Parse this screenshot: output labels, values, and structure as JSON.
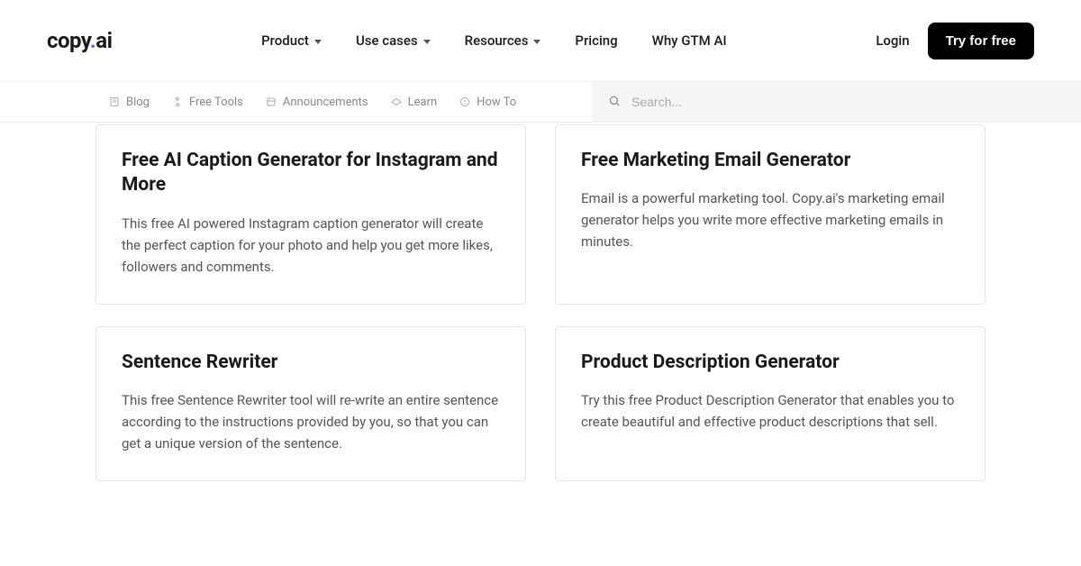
{
  "logo": {
    "part1": "copy",
    "part2": ".",
    "part3": "ai"
  },
  "nav": {
    "product": "Product",
    "use_cases": "Use cases",
    "resources": "Resources",
    "pricing": "Pricing",
    "why_gtm": "Why GTM AI"
  },
  "header": {
    "login": "Login",
    "cta": "Try for free"
  },
  "subnav": {
    "blog": "Blog",
    "free_tools": "Free Tools",
    "announcements": "Announcements",
    "learn": "Learn",
    "how_to": "How To"
  },
  "search": {
    "placeholder": "Search..."
  },
  "cards": [
    {
      "title": "Free AI Caption Generator for Instagram and More",
      "desc": "This free AI powered Instagram caption generator will create the perfect caption for your photo and help you get more likes, followers and comments."
    },
    {
      "title": "Free Marketing Email Generator",
      "desc": "Email is a powerful marketing tool. Copy.ai's marketing email generator helps you write more effective marketing emails in minutes."
    },
    {
      "title": "Sentence Rewriter",
      "desc": "This free Sentence Rewriter tool will re-write an entire sentence according to the instructions provided by you, so that you can get a unique version of the sentence."
    },
    {
      "title": "Product Description Generator",
      "desc": "Try this free Product Description Generator that enables you to create beautiful and effective product descriptions that sell."
    }
  ]
}
